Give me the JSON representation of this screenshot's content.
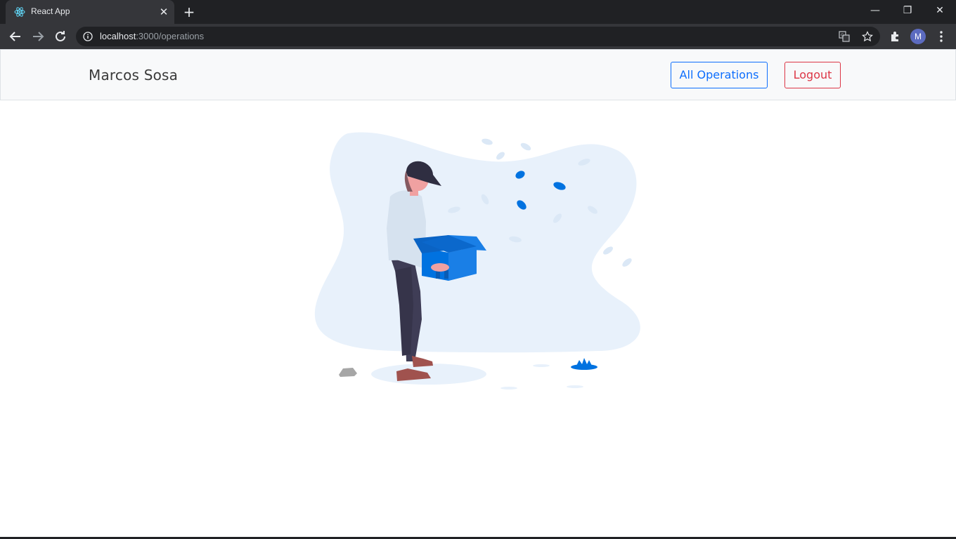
{
  "browser": {
    "tab_title": "React App",
    "tab_close": "✕",
    "new_tab": "+",
    "url_host": "localhost",
    "url_rest": ":3000/operations",
    "profile_initial": "M",
    "window_controls": {
      "minimize": "—",
      "restore": "❐",
      "close": "✕"
    }
  },
  "navbar": {
    "brand": "Marcos Sosa",
    "all_operations_label": "All Operations",
    "logout_label": "Logout"
  },
  "colors": {
    "primary": "#0d6efd",
    "danger": "#dc3545",
    "illustration_accent": "#0072e0",
    "blob": "#e8f1fb"
  },
  "icons": [
    "react-icon",
    "back-arrow-icon",
    "forward-arrow-icon",
    "reload-icon",
    "info-icon",
    "translate-icon",
    "star-icon",
    "extensions-icon",
    "menu-dots-icon",
    "empty-box-illustration"
  ]
}
